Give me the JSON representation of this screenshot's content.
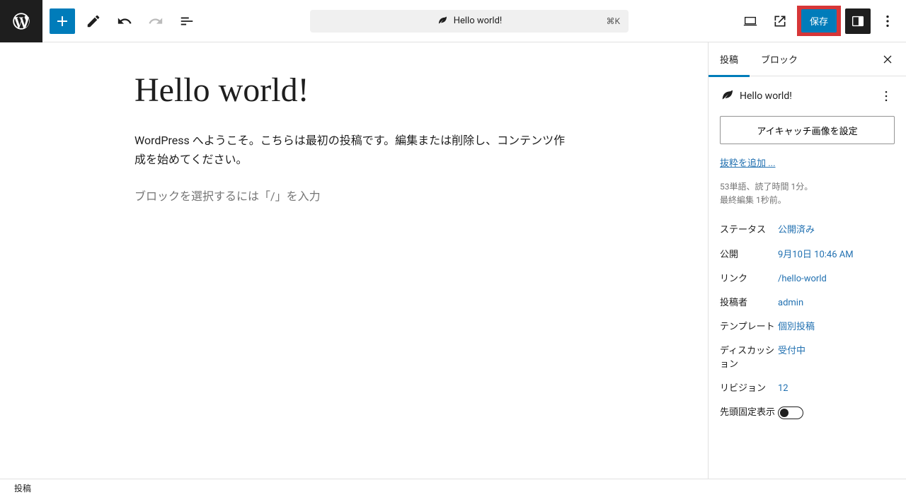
{
  "topbar": {
    "doc_title": "Hello world!",
    "kbd": "⌘K",
    "save_label": "保存"
  },
  "tabs": {
    "post": "投稿",
    "block": "ブロック"
  },
  "canvas": {
    "title": "Hello world!",
    "body": "WordPress へようこそ。こちらは最初の投稿です。編集または削除し、コンテンツ作成を始めてください。",
    "placeholder": "ブロックを選択するには「/」を入力"
  },
  "summary": {
    "post_title": "Hello world!",
    "featured_btn": "アイキャッチ画像を設定",
    "excerpt_link": "抜粋を追加 ...",
    "meta_line1": "53単語、読了時間 1分。",
    "meta_line2": "最終編集 1秒前。"
  },
  "rows": {
    "status_label": "ステータス",
    "status_value": "公開済み",
    "publish_label": "公開",
    "publish_value": "9月10日 10:46 AM",
    "link_label": "リンク",
    "link_value": "/hello-world",
    "author_label": "投稿者",
    "author_value": "admin",
    "template_label": "テンプレート",
    "template_value": "個別投稿",
    "discussion_label": "ディスカッション",
    "discussion_value": "受付中",
    "revisions_label": "リビジョン",
    "revisions_value": "12",
    "sticky_label": "先頭固定表示"
  },
  "bottombar": {
    "breadcrumb": "投稿"
  }
}
